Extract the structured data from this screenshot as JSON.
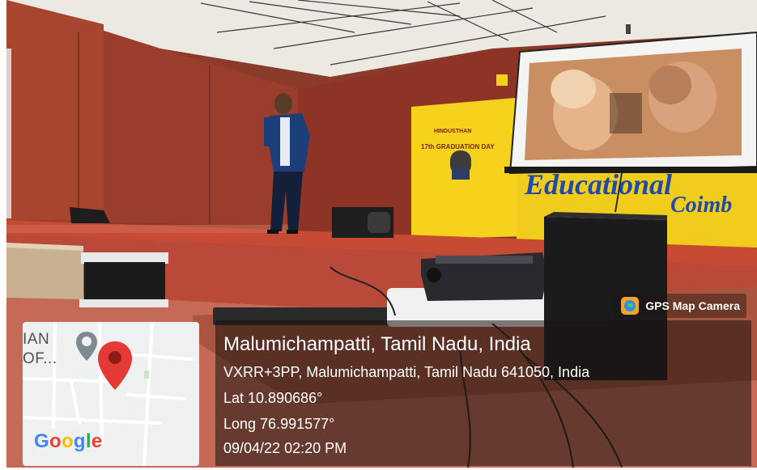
{
  "photo": {
    "subject": "event-hall-with-speaker-on-stage"
  },
  "map": {
    "label_line1": "IAN",
    "label_line2": "OF...",
    "logo": "Google",
    "pin_icon": "map-pin-icon",
    "pin_color": "#e53935",
    "gray_pin_color": "#7d8a92"
  },
  "camera": {
    "app_name": "GPS Map Camera",
    "app_icon": "gps-map-camera-icon"
  },
  "location": {
    "title": "Malumichampatti, Tamil Nadu, India",
    "address": "VXRR+3PP, Malumichampatti, Tamil Nadu 641050, India",
    "lat": "Lat 10.890686°",
    "long": "Long 76.991577°",
    "datetime": "09/04/22 02:20 PM"
  },
  "banner": {
    "line1": "HINDUSTHAN",
    "line2": "17th GRADUATION DAY",
    "background": "#f5d21c",
    "sign_text": "Educational",
    "sign_text2": "Coimb"
  }
}
